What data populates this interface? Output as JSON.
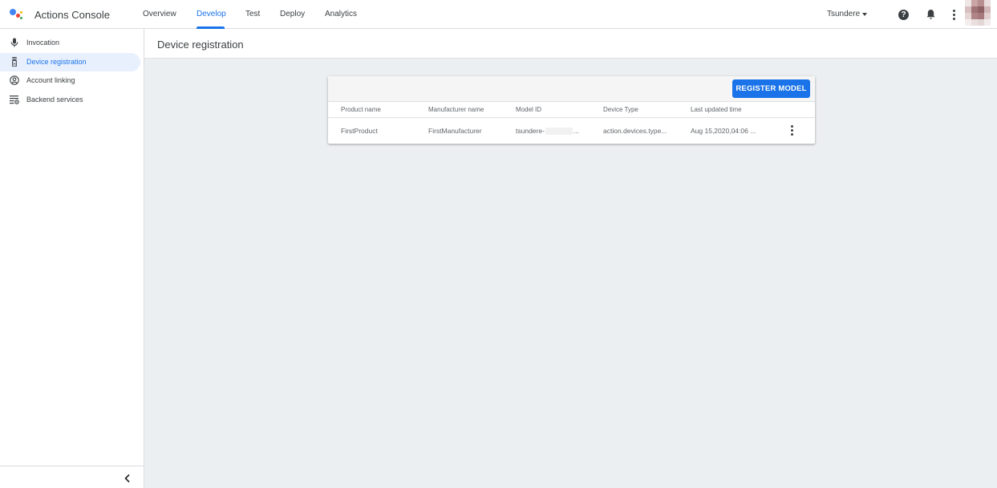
{
  "app": {
    "title": "Actions Console"
  },
  "nav": {
    "tabs": [
      {
        "label": "Overview"
      },
      {
        "label": "Develop",
        "active": true
      },
      {
        "label": "Test"
      },
      {
        "label": "Deploy"
      },
      {
        "label": "Analytics"
      }
    ]
  },
  "header_right": {
    "project_name": "Tsundere",
    "help_icon": "help-circle-icon",
    "help_glyph": "?",
    "notifications_icon": "bell-icon",
    "more_icon": "more-vert-icon"
  },
  "sidebar": {
    "items": [
      {
        "label": "Invocation",
        "icon": "mic-icon"
      },
      {
        "label": "Device registration",
        "icon": "device-icon",
        "active": true
      },
      {
        "label": "Account linking",
        "icon": "account-circle-icon"
      },
      {
        "label": "Backend services",
        "icon": "settings-list-icon"
      }
    ],
    "collapse_icon": "chevron-left-icon"
  },
  "page": {
    "title": "Device registration"
  },
  "table": {
    "register_button_label": "REGISTER MODEL",
    "columns": [
      "Product name",
      "Manufacturer name",
      "Model ID",
      "Device Type",
      "Last updated time"
    ],
    "rows": [
      {
        "product_name": "FirstProduct",
        "manufacturer_name": "FirstManufacturer",
        "model_id_prefix": "tsundere-",
        "model_id_suffix": "...",
        "device_type": "action.devices.type...",
        "last_updated": "Aug 15,2020,04:06 ..."
      }
    ]
  },
  "colors": {
    "accent": "#1a73e8",
    "active_bg": "#e8f0fe",
    "main_bg": "#eceff1"
  }
}
